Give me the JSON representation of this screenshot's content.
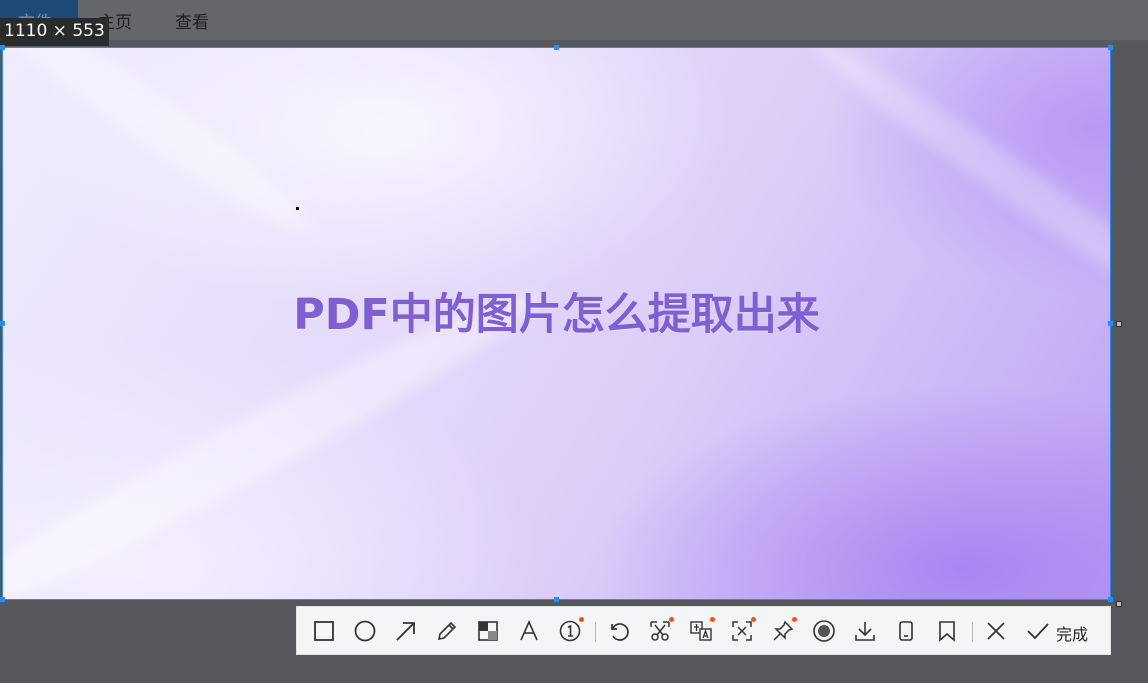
{
  "menubar": {
    "file": "文件",
    "home": "主页",
    "view": "查看"
  },
  "capture": {
    "size_label": "1110 × 553",
    "headline": "PDF中的图片怎么提取出来"
  },
  "toolbar": {
    "tools": [
      {
        "name": "rectangle-icon",
        "has_dot": false
      },
      {
        "name": "ellipse-icon",
        "has_dot": false
      },
      {
        "name": "arrow-icon",
        "has_dot": false
      },
      {
        "name": "pencil-icon",
        "has_dot": false
      },
      {
        "name": "mosaic-icon",
        "has_dot": false
      },
      {
        "name": "text-icon",
        "has_dot": false
      },
      {
        "name": "number-marker-icon",
        "has_dot": true
      },
      {
        "name": "undo-icon",
        "has_dot": false
      },
      {
        "name": "scissors-icon",
        "has_dot": true
      },
      {
        "name": "translate-icon",
        "has_dot": true
      },
      {
        "name": "ocr-icon",
        "has_dot": true
      },
      {
        "name": "pin-icon",
        "has_dot": true
      },
      {
        "name": "record-icon",
        "has_dot": false
      },
      {
        "name": "download-icon",
        "has_dot": false
      },
      {
        "name": "phone-icon",
        "has_dot": false
      },
      {
        "name": "bookmark-icon",
        "has_dot": false
      },
      {
        "name": "close-icon",
        "has_dot": false
      },
      {
        "name": "check-icon",
        "has_dot": false
      }
    ],
    "done_label": "完成",
    "accent_color": "#1e90ff",
    "dot_color": "#ff4d1a"
  }
}
